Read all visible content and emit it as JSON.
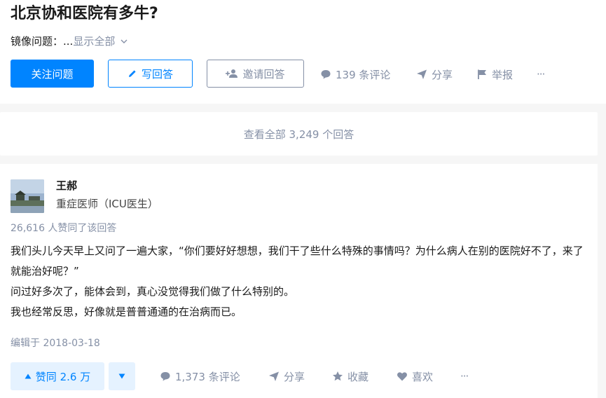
{
  "question": {
    "title": "北京协和医院有多牛?",
    "mirror_label": "镜像问题：",
    "mirror_ellipsis": "...",
    "show_all": "显示全部",
    "follow_label": "关注问题",
    "write_label": "写回答",
    "invite_label": "邀请回答",
    "comments": "139 条评论",
    "share": "分享",
    "report": "举报",
    "more": "···"
  },
  "view_all": "查看全部 3,249 个回答",
  "answer": {
    "author_name": "王郝",
    "author_bio": "重症医师（ICU医生）",
    "vote_summary": "26,616 人赞同了该回答",
    "paragraphs": [
      "我们头儿今天早上又问了一遍大家，“你们要好好想想，我们干了些什么特殊的事情吗？为什么病人在别的医院好不了，来了就能治好呢？”",
      "问过好多次了，能体会到，真心没觉得我们做了什么特别的。",
      "我也经常反思，好像就是普普通通的在治病而已。"
    ],
    "edited": "编辑于 2018-03-18",
    "upvote": "赞同 2.6 万",
    "comments": "1,373 条评论",
    "share": "分享",
    "collect": "收藏",
    "like": "喜欢",
    "more": "···"
  },
  "colors": {
    "primary": "#0084ff",
    "muted": "#8590a6",
    "upvote_bg": "#e5f2ff",
    "page_bg": "#f6f6f6"
  },
  "icons": [
    "chevron-down-icon",
    "pencil-icon",
    "add-user-icon",
    "comment-icon",
    "share-icon",
    "flag-icon",
    "triangle-up-icon",
    "triangle-down-icon",
    "star-icon",
    "heart-icon"
  ]
}
